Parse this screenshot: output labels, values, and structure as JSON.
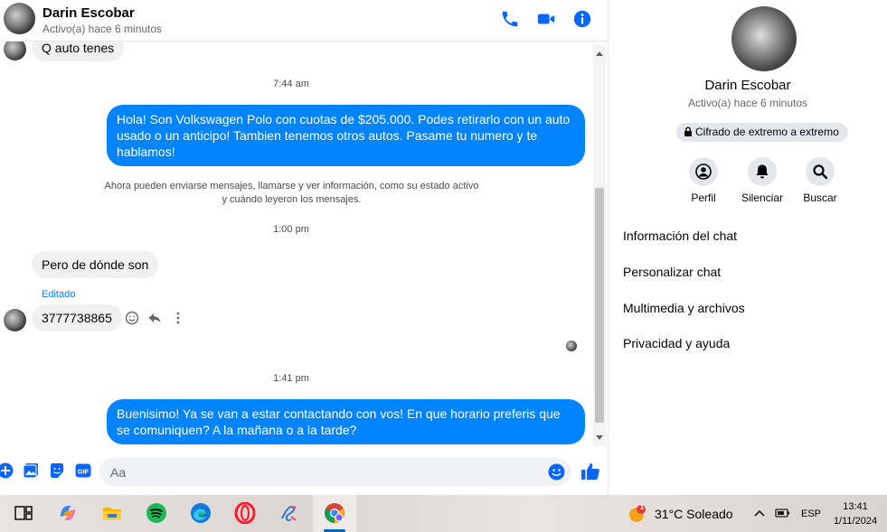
{
  "header": {
    "contact_name": "Darin Escobar",
    "status": "Activo(a) hace 6 minutos"
  },
  "messages": {
    "partial_incoming": "Q auto tenes",
    "time_1": "7:44 am",
    "outgoing_1": "Hola! Son Volkswagen Polo con cuotas de $205.000. Podes retirarlo con un auto usado o un anticipo! Tambien tenemos otros autos. Pasame tu numero y te hablamos!",
    "system_notice_line1": "Ahora pueden enviarse mensajes, llamarse y ver información, como su estado activo",
    "system_notice_line2": "y cuándo leyeron los mensajes.",
    "time_2": "1:00 pm",
    "incoming_1": "Pero de dónde son",
    "edited_label": "Editado",
    "incoming_2": "3777738865",
    "time_3": "1:41 pm",
    "outgoing_2": "Buenisimo! Ya se van a estar contactando con vos! En que horario preferis que se comuniquen? A la mañana o a la tarde?"
  },
  "composer": {
    "placeholder": "Aa"
  },
  "info_panel": {
    "name": "Darin Escobar",
    "status": "Activo(a) hace 6 minutos",
    "encryption_badge": "Cifrado de extremo a extremo",
    "actions": [
      {
        "label": "Perfil",
        "icon": "profile-icon"
      },
      {
        "label": "Silenciar",
        "icon": "bell-icon"
      },
      {
        "label": "Buscar",
        "icon": "search-icon"
      }
    ],
    "menu": [
      "Información del chat",
      "Personalizar chat",
      "Multimedia y archivos",
      "Privacidad y ayuda"
    ]
  },
  "taskbar": {
    "weather_badge": "1",
    "weather": "31°C  Soleado",
    "language": "ESP",
    "time": "13:41",
    "date": "1/11/2024",
    "apps": [
      "task-view-icon",
      "copilot-icon",
      "file-explorer-icon",
      "spotify-icon",
      "edge-icon",
      "opera-icon",
      "paint-icon",
      "chrome-icon"
    ]
  },
  "colors": {
    "accent": "#0084ff",
    "icon_blue": "#0866ff",
    "incoming_bubble": "#f0f0f0"
  }
}
